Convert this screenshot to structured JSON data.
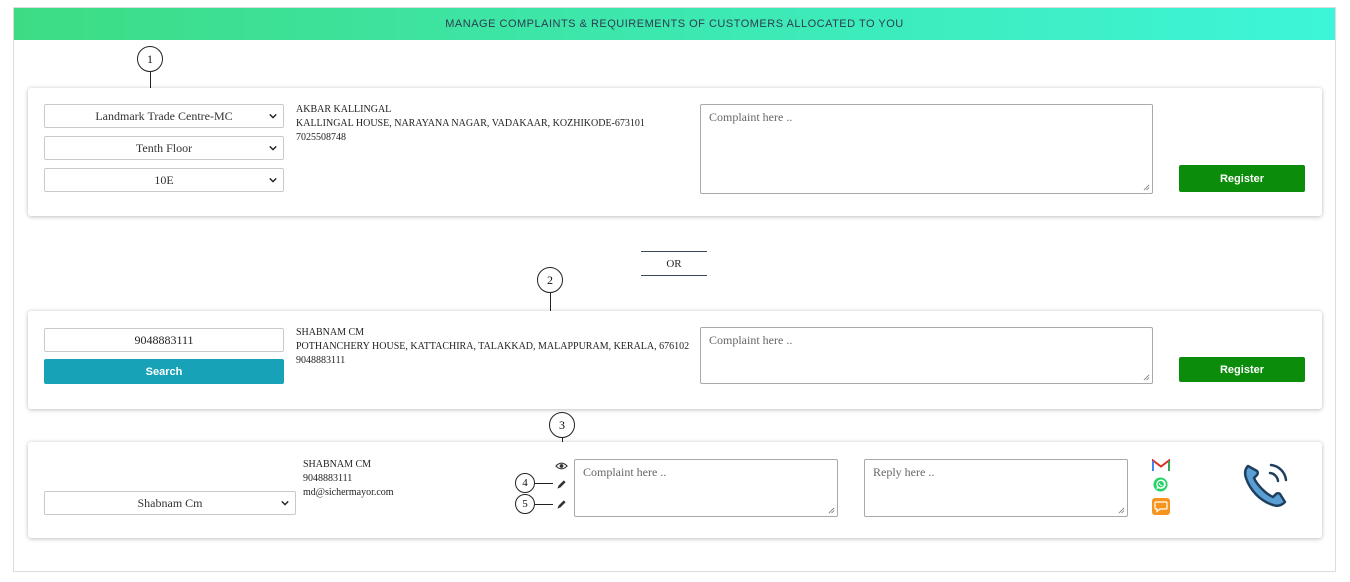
{
  "header": {
    "title": "MANAGE COMPLAINTS & REQUIREMENTS OF CUSTOMERS ALLOCATED TO YOU"
  },
  "annotations": [
    "1",
    "2",
    "3",
    "4",
    "5"
  ],
  "card1": {
    "building_select": "Landmark Trade Centre-MC",
    "floor_select": "Tenth Floor",
    "unit_select": "10E",
    "customer": {
      "name": "AKBAR KALLINGAL",
      "address": "KALLINGAL HOUSE, NARAYANA NAGAR, VADAKAAR, KOZHIKODE-673101",
      "phone": "7025508748"
    },
    "complaint_placeholder": "Complaint here ..",
    "register_label": "Register"
  },
  "or_label": "OR",
  "card2": {
    "phone_input": "9048883111",
    "search_label": "Search",
    "customer": {
      "name": "SHABNAM CM",
      "address": "POTHANCHERY HOUSE, KATTACHIRA, TALAKKAD, MALAPPURAM, KERALA, 676102",
      "phone": "9048883111"
    },
    "complaint_placeholder": "Complaint here ..",
    "register_label": "Register"
  },
  "card3": {
    "customer_select": "Shabnam Cm",
    "customer": {
      "name": "SHABNAM CM",
      "phone": "9048883111",
      "email": "md@sichermayor.com"
    },
    "icons": [
      "eye-icon",
      "pencil-icon",
      "pencil-icon"
    ],
    "complaint_placeholder": "Complaint here ..",
    "reply_placeholder": "Reply here ..",
    "contact_icons": [
      "gmail-icon",
      "whatsapp-icon",
      "sms-icon"
    ],
    "call_icon": "phone-call-icon"
  },
  "colors": {
    "header_gradient_start": "#3ddc84",
    "header_gradient_end": "#3df5d8",
    "register_green": "#0b8c0b",
    "search_teal": "#18a2b8",
    "call_icon_blue": "#2d5c8a"
  }
}
